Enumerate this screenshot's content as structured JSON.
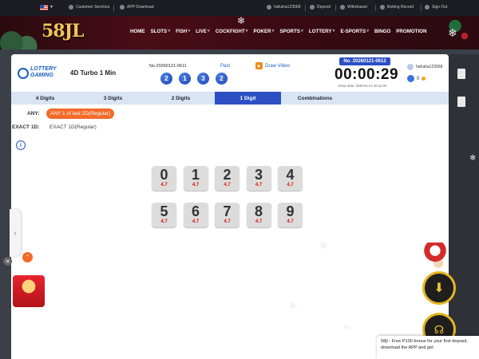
{
  "topbar": {
    "customer_service": "Customer Services",
    "app_download": "APP Download",
    "username": "hahaha123568",
    "deposit": "Deposit",
    "withdrawal": "Withdrawal",
    "betting_record": "Betting Record",
    "sign_out": "Sign Out"
  },
  "header": {
    "logo": "58JL",
    "nav": [
      "HOME",
      "SLOTS",
      "FISH",
      "LIVE",
      "COCKFIGHT",
      "POKER",
      "SPORTS",
      "LOTTERY",
      "E-SPORTS",
      "BINGO",
      "PROMOTION"
    ],
    "nav_has_caret": [
      false,
      true,
      true,
      true,
      true,
      true,
      true,
      true,
      true,
      false,
      false
    ]
  },
  "game": {
    "provider_line1": "LOTTERY",
    "provider_line2": "GAMING",
    "title": "4D Turbo 1 Min",
    "previous_no": "No.20260121-0611",
    "past_label": "Past",
    "past_balls": [
      "2",
      "1",
      "3",
      "2"
    ],
    "video_label": "Draw Video",
    "current_no": "No. 20260121-0612",
    "countdown": "00:00:29",
    "draw_date": "Draw date: 2026-01-21 00:11:00",
    "account_user": "hahaha123568",
    "balance": "0"
  },
  "tabs": [
    {
      "label": "4 Digits",
      "active": false
    },
    {
      "label": "3 Digits",
      "active": false
    },
    {
      "label": "2 Digits",
      "active": false
    },
    {
      "label": "1 Digit",
      "active": true
    },
    {
      "label": "Combinations",
      "active": false
    }
  ],
  "bet": {
    "any_label": "ANY:",
    "any_option": "ANY 1 of last 2D(Regular)",
    "exact_label": "EXACT 1D:",
    "exact_value": "EXACT 1D(Regular)",
    "info_icon": "i"
  },
  "digits": [
    {
      "num": "0",
      "odds": "4.7"
    },
    {
      "num": "1",
      "odds": "4.7"
    },
    {
      "num": "2",
      "odds": "4.7"
    },
    {
      "num": "3",
      "odds": "4.7"
    },
    {
      "num": "4",
      "odds": "4.7"
    },
    {
      "num": "5",
      "odds": "4.7"
    },
    {
      "num": "6",
      "odds": "4.7"
    },
    {
      "num": "7",
      "odds": "4.7"
    },
    {
      "num": "8",
      "odds": "4.7"
    },
    {
      "num": "9",
      "odds": "4.7"
    }
  ],
  "floating": {
    "toast_text": "58jl - Free P100 bonus for your first deposit, download the APP and get"
  },
  "colors": {
    "primary_blue": "#2c4fc4",
    "accent_orange": "#f26b2a",
    "odds_red": "#d11111",
    "header_maroon": "#4a0d17",
    "gold": "#e6b422"
  }
}
